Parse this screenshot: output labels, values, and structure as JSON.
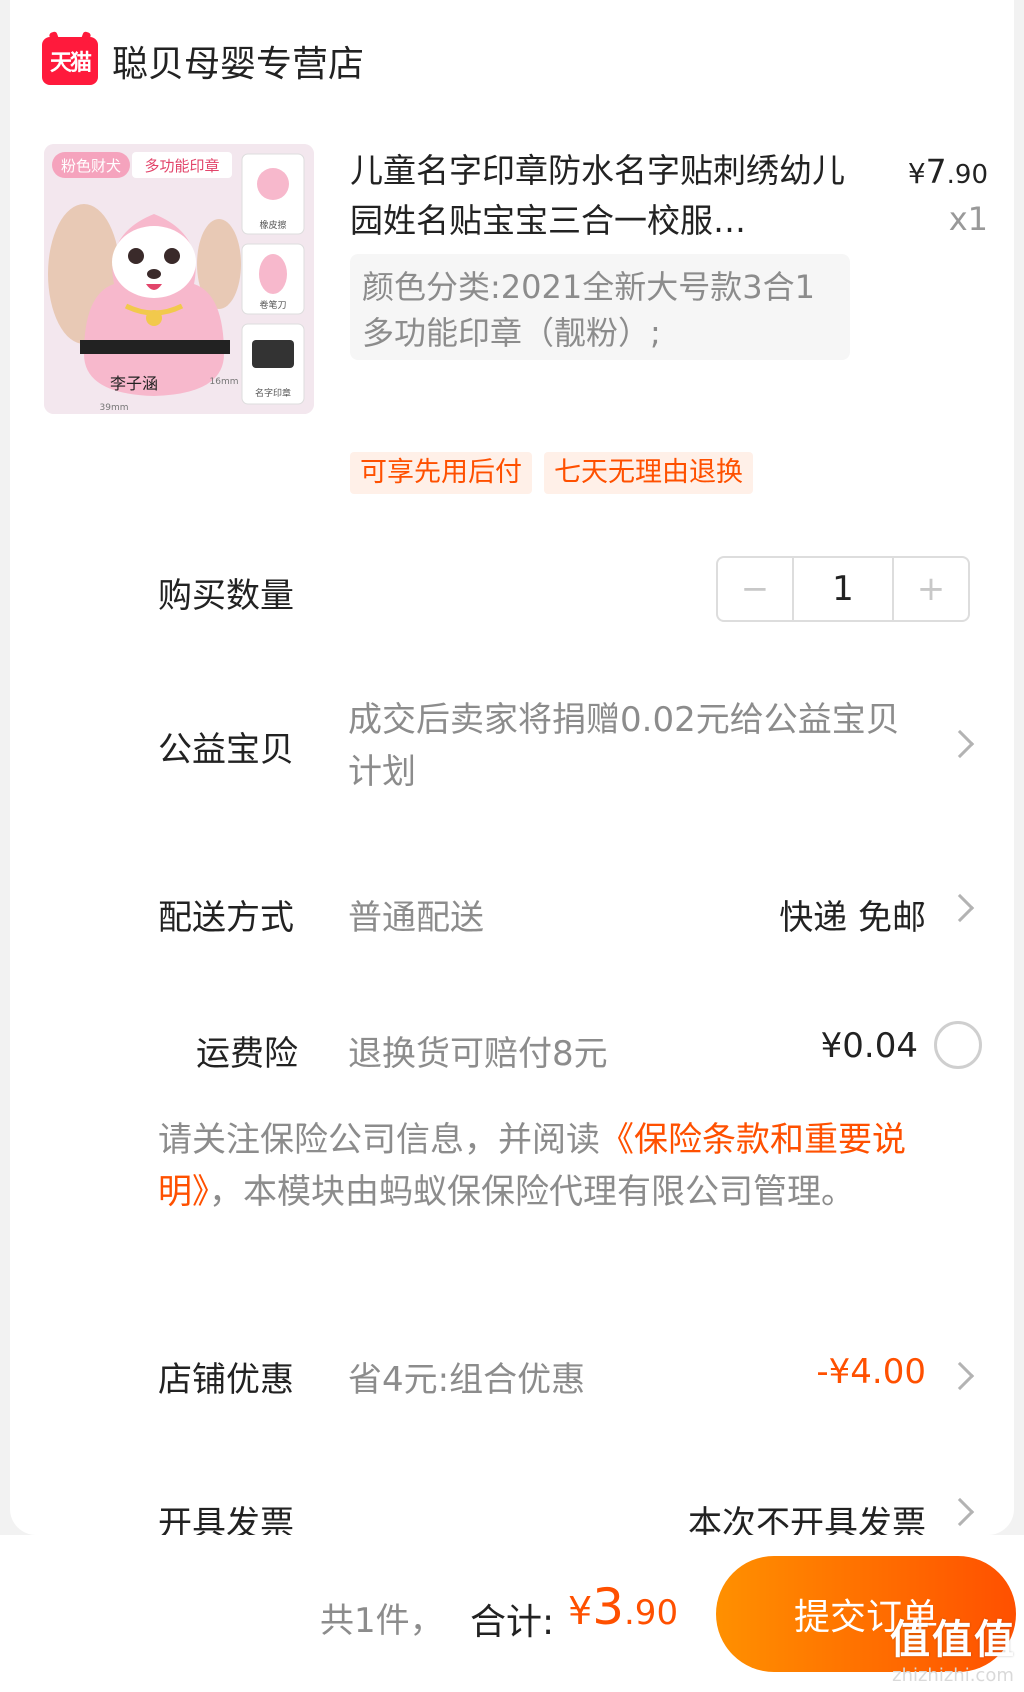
{
  "store": {
    "logo_text": "天猫",
    "name": "聪贝母婴专营店"
  },
  "product": {
    "image_badge_1": "粉色财犬",
    "image_badge_2": "多功能印章",
    "image_caption_1": "橡皮擦",
    "image_caption_2": "卷笔刀",
    "image_caption_3": "名字印章",
    "image_stamp_text": "李子涵",
    "image_size_w": "39mm",
    "image_size_h": "16mm",
    "title": "儿童名字印章防水名字贴刺绣幼儿园姓名贴宝宝三合一校服…",
    "price_symbol": "¥",
    "price_int": "7",
    "price_dec": ".90",
    "quantity_label": "x1",
    "sku": "颜色分类:2021全新大号款3合1多功能印章（靓粉）;",
    "tags": [
      "可享先用后付",
      "七天无理由退换"
    ]
  },
  "quantity": {
    "label": "购买数量",
    "value": "1",
    "minus": "−",
    "plus": "+"
  },
  "charity": {
    "label": "公益宝贝",
    "text": "成交后卖家将捐赠0.02元给公益宝贝计划"
  },
  "delivery": {
    "label": "配送方式",
    "method": "普通配送",
    "detail": "快递 免邮"
  },
  "shipping_insurance": {
    "label": "运费险",
    "text": "退换货可赔付8元",
    "price": "¥0.04"
  },
  "insurance_notice": {
    "prefix": "请关注保险公司信息，并阅读",
    "link": "《保险条款和重要说明》",
    "suffix": "，本模块由蚂蚁保保险代理有限公司管理。"
  },
  "store_discount": {
    "label": "店铺优惠",
    "text": "省4元:组合优惠",
    "amount": "-¥4.00"
  },
  "invoice": {
    "label": "开具发票",
    "value": "本次不开具发票"
  },
  "footer": {
    "count_text": "共1件，",
    "total_label": "合计:",
    "total_symbol": "¥",
    "total_int": "3",
    "total_dec": ".90",
    "submit_label": "提交订单"
  },
  "watermark": {
    "main": "值值值",
    "url": "zhizhizhi.com"
  },
  "colors": {
    "accent": "#ff5000",
    "tmall_red": "#ff1a3c",
    "muted": "#8c8c8c"
  },
  "icons": [
    "tmall-logo-icon",
    "chevron-right-icon",
    "radio-unchecked-icon"
  ]
}
